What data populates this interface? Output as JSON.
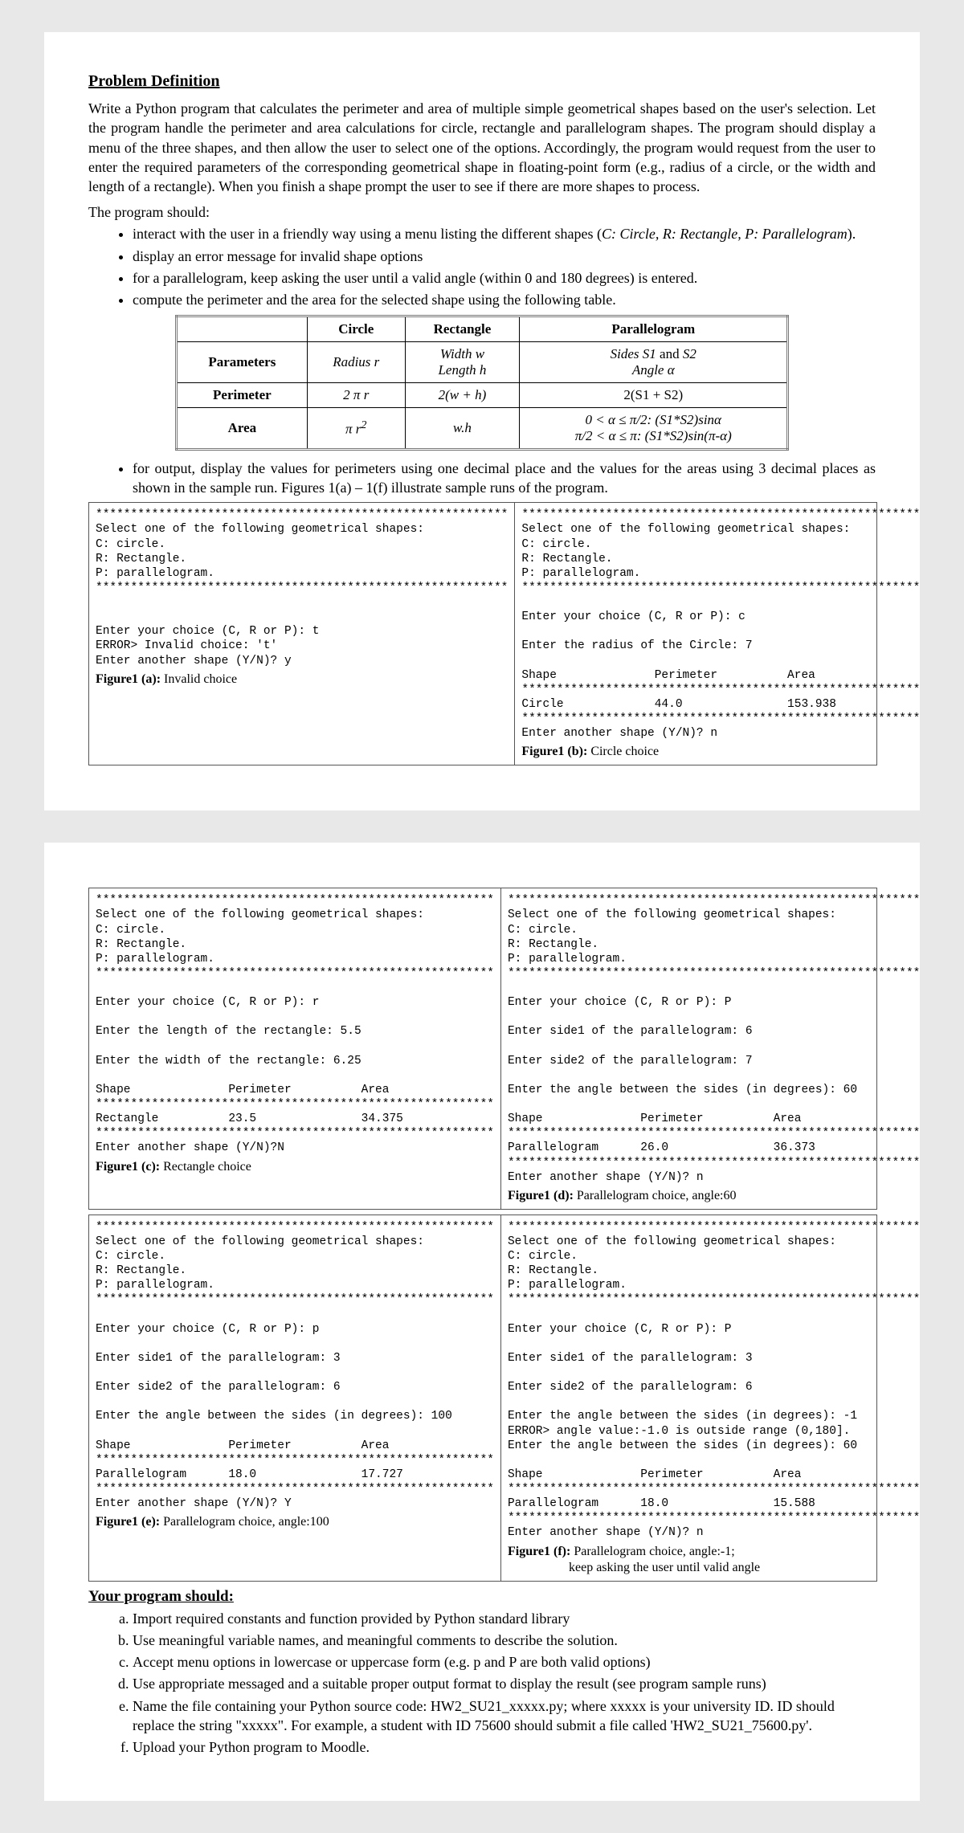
{
  "title": "Problem Definition",
  "intro": "Write a Python program that calculates the perimeter and area of multiple simple geometrical shapes based on the user's selection. Let the program handle the perimeter and area calculations for circle, rectangle and parallelogram shapes. The program should display a menu of the three shapes, and then allow the user to select one of the options. Accordingly, the program would request from the user to enter the required parameters of the corresponding geometrical shape in floating-point form (e.g., radius of a circle, or the width and length of a rectangle). When you finish a shape prompt the user to see if there are more shapes to process.",
  "lead": "The program should:",
  "bullets1": [
    "interact with the user in a friendly way using a menu listing the different shapes (C: Circle, R: Rectangle, P: Parallelogram).",
    "display an error message for invalid shape options",
    "for a parallelogram, keep asking the user until a valid angle (within 0 and 180 degrees) is entered.",
    "compute the perimeter and the area for the selected shape using the following table."
  ],
  "table": {
    "head": [
      "",
      "Circle",
      "Rectangle",
      "Parallelogram"
    ],
    "rows": [
      {
        "h": "Parameters",
        "c": "Radius r",
        "r": "Width w\nLength h",
        "p": "Sides S1 and S2\nAngle α"
      },
      {
        "h": "Perimeter",
        "c": "2 π r",
        "r": "2(w + h)",
        "p": "2(S1 + S2)"
      },
      {
        "h": "Area",
        "c": "π r²",
        "r": "w.h",
        "p": "0 < α ≤ π/2: (S1*S2)sinα\nπ/2 < α ≤ π: (S1*S2)sin(π-α)"
      }
    ]
  },
  "bullet2": "for output, display the values for perimeters using one decimal place and the values for the areas using 3 decimal places as shown in the sample run.  Figures 1(a) – 1(f) illustrate sample runs of the program.",
  "figA": {
    "text": "***********************************************************\nSelect one of the following geometrical shapes:\nC: circle.\nR: Rectangle.\nP: parallelogram.\n***********************************************************\n\n\nEnter your choice (C, R or P): t\nERROR> Invalid choice: 't'\nEnter another shape (Y/N)? y",
    "caption": "Figure1 (a): Invalid choice"
  },
  "figB": {
    "text": "*********************************************************\nSelect one of the following geometrical shapes:\nC: circle.\nR: Rectangle.\nP: parallelogram.\n*********************************************************\n\nEnter your choice (C, R or P): c\n\nEnter the radius of the Circle: 7\n\nShape              Perimeter          Area\n*********************************************************\nCircle             44.0               153.938\n*********************************************************\nEnter another shape (Y/N)? n",
    "caption": "Figure1 (b): Circle choice"
  },
  "figC": {
    "text": "*********************************************************\nSelect one of the following geometrical shapes:\nC: circle.\nR: Rectangle.\nP: parallelogram.\n*********************************************************\n\nEnter your choice (C, R or P): r\n\nEnter the length of the rectangle: 5.5\n\nEnter the width of the rectangle: 6.25\n\nShape              Perimeter          Area\n*********************************************************\nRectangle          23.5               34.375\n*********************************************************\nEnter another shape (Y/N)?N",
    "caption": "Figure1 (c): Rectangle choice"
  },
  "figD": {
    "text": "***********************************************************\nSelect one of the following geometrical shapes:\nC: circle.\nR: Rectangle.\nP: parallelogram.\n***********************************************************\n\nEnter your choice (C, R or P): P\n\nEnter side1 of the parallelogram: 6\n\nEnter side2 of the parallelogram: 7\n\nEnter the angle between the sides (in degrees): 60\n\nShape              Perimeter          Area\n***********************************************************\nParallelogram      26.0               36.373\n***********************************************************\nEnter another shape (Y/N)? n",
    "caption": "Figure1 (d): Parallelogram choice, angle:60"
  },
  "figE": {
    "text": "*********************************************************\nSelect one of the following geometrical shapes:\nC: circle.\nR: Rectangle.\nP: parallelogram.\n*********************************************************\n\nEnter your choice (C, R or P): p\n\nEnter side1 of the parallelogram: 3\n\nEnter side2 of the parallelogram: 6\n\nEnter the angle between the sides (in degrees): 100\n\nShape              Perimeter          Area\n*********************************************************\nParallelogram      18.0               17.727\n*********************************************************\nEnter another shape (Y/N)? Y",
    "caption": "Figure1 (e): Parallelogram choice, angle:100"
  },
  "figF": {
    "text": "***********************************************************\nSelect one of the following geometrical shapes:\nC: circle.\nR: Rectangle.\nP: parallelogram.\n***********************************************************\n\nEnter your choice (C, R or P): P\n\nEnter side1 of the parallelogram: 3\n\nEnter side2 of the parallelogram: 6\n\nEnter the angle between the sides (in degrees): -1\nERROR> angle value:-1.0 is outside range (0,180].\nEnter the angle between the sides (in degrees): 60\n\nShape              Perimeter          Area\n***********************************************************\nParallelogram      18.0               15.588\n***********************************************************\nEnter another shape (Y/N)? n",
    "caption1": "Figure1 (f): Parallelogram choice, angle:-1;",
    "caption2": "keep asking the user until valid angle"
  },
  "your_prog": "Your program should:",
  "alpha": [
    "Import required constants and function provided by Python standard library",
    "Use meaningful variable names, and meaningful comments to describe the solution.",
    "Accept menu options in lowercase or uppercase form (e.g. p and P are both valid options)",
    "Use appropriate messaged and a suitable proper output format to display the result (see program sample runs)",
    "Name the file containing your Python source code: HW2_SU21_xxxxx.py; where xxxxx is your university ID. ID should replace the string \"xxxxx\". For example, a student with ID 75600 should submit a file called 'HW2_SU21_75600.py'.",
    "Upload your Python program to Moodle."
  ]
}
